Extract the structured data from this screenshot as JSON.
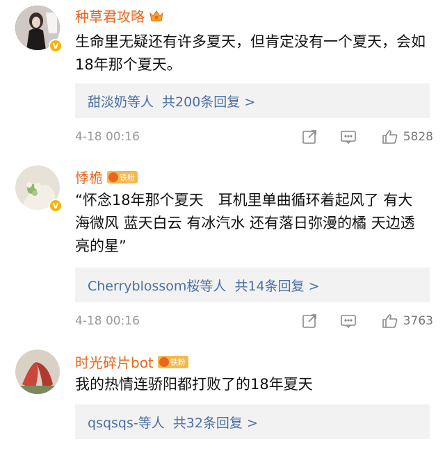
{
  "comments": [
    {
      "user": "种草君攻略",
      "fan_badge": "",
      "text": "生命里无疑还有许多夏天，但肯定没有一个夏天，会如18年那个夏天。",
      "reply_users": "甜淡奶等人",
      "reply_count": "共200条回复 >",
      "time": "4-18 00:16",
      "likes": "5828"
    },
    {
      "user": "悸桅",
      "fan_badge": "铁粉",
      "text": "“怀念18年那个夏天　耳机里单曲循环着起风了 有大海微风 蓝天白云 有冰汽水 还有落日弥漫的橘 天边透亮的星”",
      "reply_users": "Cherryblossom桜等人",
      "reply_count": "共14条回复 >",
      "time": "4-18 00:16",
      "likes": "3763"
    },
    {
      "user": "时光碎片bot",
      "fan_badge": "铁粉",
      "text": "我的热情连骄阳都打败了的18年夏天",
      "reply_users": "qsqsqs-等人",
      "reply_count": "共32条回复 >",
      "time": "",
      "likes": ""
    }
  ],
  "colors": {
    "username": "#e8661f",
    "reply_link": "#4a6fa5",
    "reply_bg": "#f2f2f2",
    "meta": "#999999",
    "vip_badge": "#f5b400"
  },
  "icons": [
    "share-icon",
    "comment-icon",
    "like-icon",
    "crown-badge-icon",
    "verified-badge-icon"
  ]
}
